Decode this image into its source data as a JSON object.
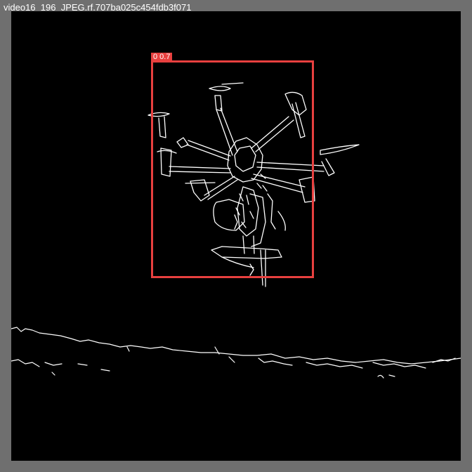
{
  "window": {
    "title": "video16_196_JPEG.rf.707ba025c454fdb3f071"
  },
  "detection": {
    "label": "0 0.7",
    "box_color": "#e8403f"
  },
  "image": {
    "description_icon": "edge-map-drone",
    "background": "#000000",
    "edge_color": "#ffffff"
  }
}
